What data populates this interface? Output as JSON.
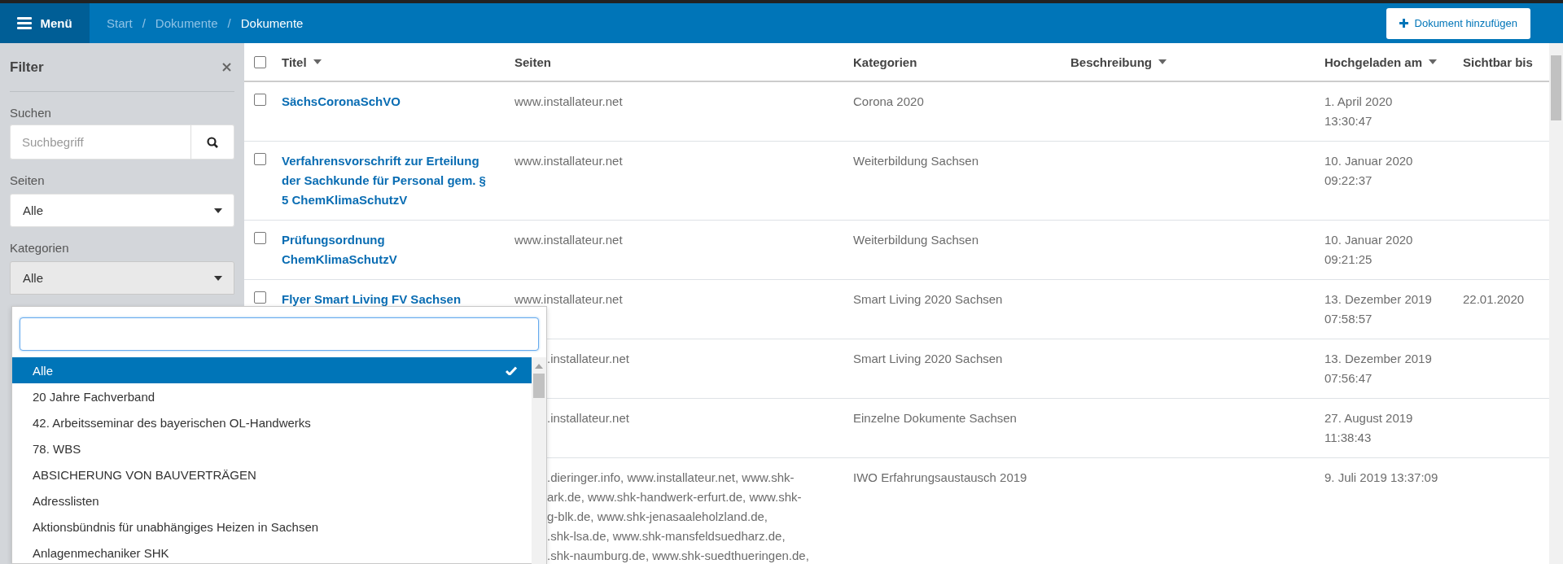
{
  "topbar": {
    "menu_button": "Menü",
    "breadcrumb": [
      {
        "label": "Start",
        "current": false
      },
      {
        "separator": "/",
        "label": "Dokumente",
        "current": false
      },
      {
        "separator": "/",
        "label": "Dokumente",
        "current": true
      }
    ],
    "add_button": "Dokument hinzufügen"
  },
  "filter": {
    "title": "Filter",
    "search": {
      "label": "Suchen",
      "placeholder": "Suchbegriff"
    },
    "seiten": {
      "label": "Seiten",
      "value": "Alle"
    },
    "kategorien": {
      "label": "Kategorien",
      "value": "Alle",
      "expanded": true
    }
  },
  "dropdown": {
    "items": [
      {
        "label": "Alle",
        "selected": true
      },
      {
        "label": "20 Jahre Fachverband",
        "selected": false
      },
      {
        "label": "42. Arbeitsseminar des bayerischen OL-Handwerks",
        "selected": false
      },
      {
        "label": "78. WBS",
        "selected": false
      },
      {
        "label": "ABSICHERUNG VON BAUVERTRÄGEN",
        "selected": false
      },
      {
        "label": "Adresslisten",
        "selected": false
      },
      {
        "label": "Aktionsbündnis für unabhängiges Heizen in Sachsen",
        "selected": false
      },
      {
        "label": "Anlagenmechaniker SHK",
        "selected": false
      }
    ]
  },
  "table": {
    "all_checked": false,
    "columns": [
      {
        "label": "Titel",
        "sortable": true
      },
      {
        "label": "Seiten",
        "sortable": false
      },
      {
        "label": "Kategorien",
        "sortable": false
      },
      {
        "label": "Beschreibung",
        "sortable": true
      },
      {
        "label": "Hochgeladen am",
        "sortable": true
      },
      {
        "label": "Sichtbar bis",
        "sortable": false
      }
    ],
    "rows": [
      {
        "checked": false,
        "title": "SächsCoronaSchVO",
        "covered": false,
        "seiten": [
          "www.installateur.net"
        ],
        "kategorie": "Corona 2020",
        "uploaded": [
          "1. April 2020",
          "13:30:47"
        ]
      },
      {
        "checked": false,
        "title": "Verfahrensvorschrift zur Erteilung der Sachkunde für Personal gem. § 5 ChemKlimaSchutzV",
        "covered": false,
        "seiten": [
          "www.installateur.net"
        ],
        "kategorie": "Weiterbildung Sachsen",
        "uploaded": [
          "10. Januar 2020",
          "09:22:37"
        ]
      },
      {
        "checked": false,
        "title": "Prüfungsordnung ChemKlimaSchutzV",
        "covered": false,
        "seiten": [
          "www.installateur.net"
        ],
        "kategorie": "Weiterbildung Sachsen",
        "uploaded": [
          "10. Januar 2020",
          "09:21:25"
        ]
      },
      {
        "checked": false,
        "title": "Flyer Smart Living FV Sachsen",
        "covered": false,
        "seiten": [
          "www.installateur.net"
        ],
        "kategorie": "Smart Living 2020 Sachsen",
        "uploaded": [
          "13. Dezember 2019",
          "07:58:57"
        ],
        "visible_until": "22.01.2020"
      },
      {
        "covered": true,
        "seiten": [
          ".installateur.net"
        ],
        "kategorie": "Smart Living 2020 Sachsen",
        "uploaded": [
          "13. Dezember 2019",
          "07:56:47"
        ]
      },
      {
        "covered": true,
        "seiten": [
          ".installateur.net"
        ],
        "kategorie": "Einzelne Dokumente Sachsen",
        "uploaded": [
          "27. August 2019",
          "11:38:43"
        ]
      },
      {
        "covered": true,
        "seiten": [
          ".dieringer.info, www.installateur.net, www.shk-",
          "ark.de, www.shk-handwerk-erfurt.de, www.shk-",
          "g-blk.de, www.shk-jenasaaleholzland.de,",
          ".shk-lsa.de, www.shk-mansfeldsuedharz.de,",
          ".shk-naumburg.de, www.shk-suedthueringen.de,"
        ],
        "kategorie": "IWO Erfahrungsaustausch 2019",
        "uploaded": [
          "9. Juli 2019 13:37:09"
        ]
      }
    ]
  }
}
